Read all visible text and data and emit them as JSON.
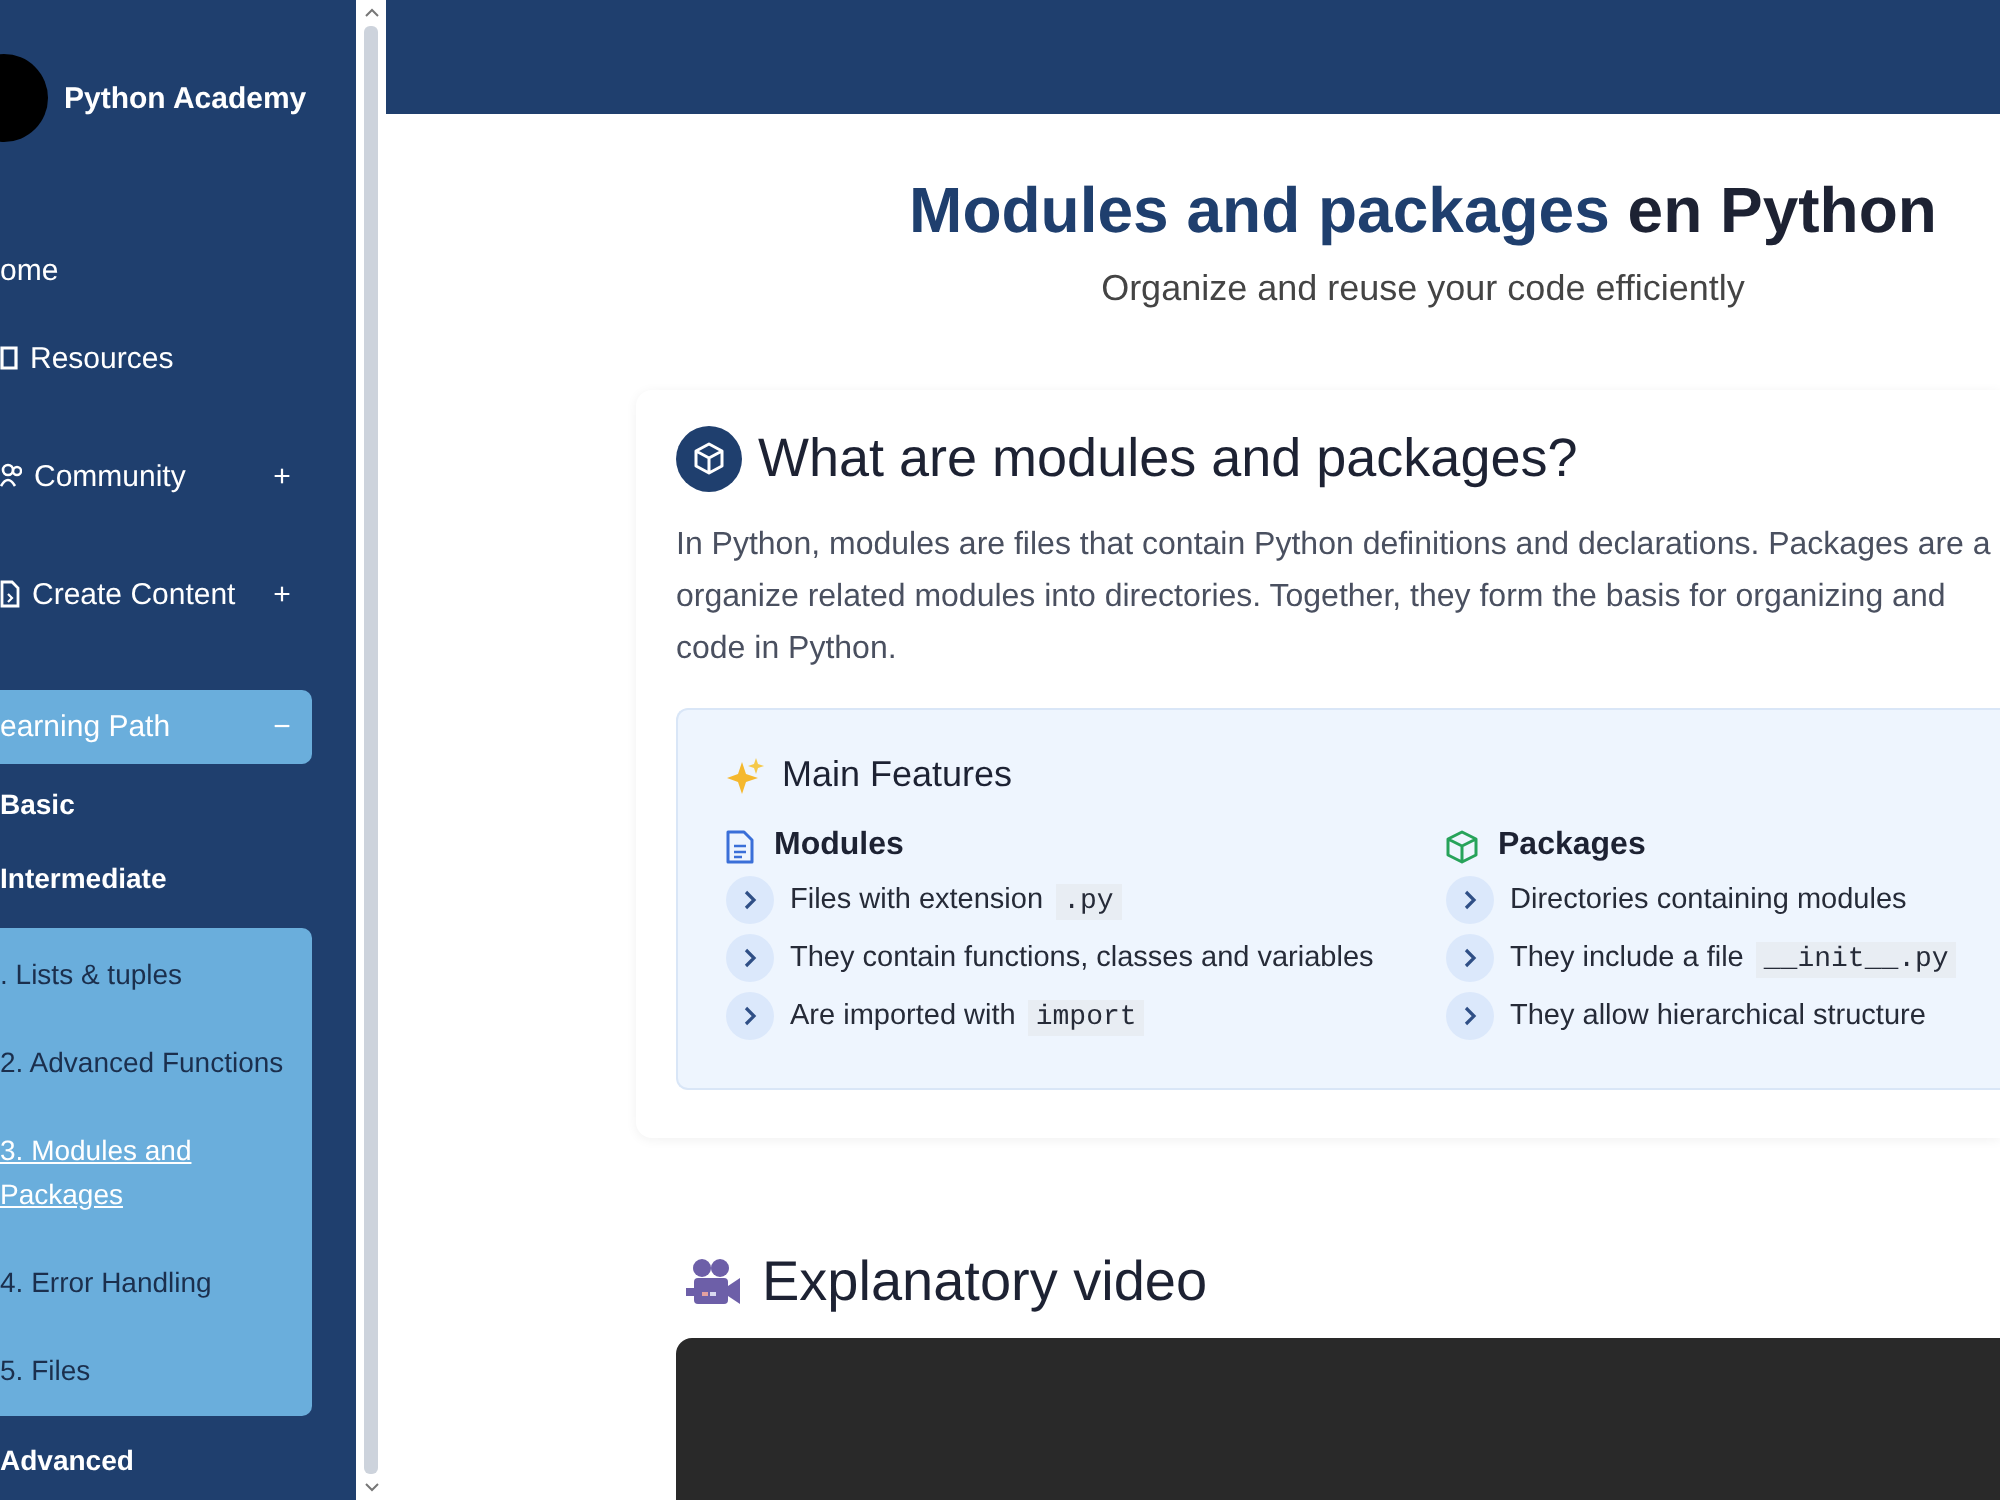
{
  "sidebar": {
    "brand": "Python Academy",
    "nav": [
      {
        "label": "ome",
        "kind": "link"
      },
      {
        "label": "Resources",
        "kind": "link"
      },
      {
        "label": "Community",
        "kind": "expandable",
        "toggle": "+",
        "expanded": false
      },
      {
        "label": "Create Content",
        "kind": "expandable",
        "toggle": "+",
        "expanded": false
      },
      {
        "label": "earning Path",
        "kind": "expandable",
        "toggle": "−",
        "expanded": true
      }
    ],
    "levels": [
      {
        "label": "Basic"
      },
      {
        "label": "Intermediate",
        "children": [
          {
            "label": ". Lists & tuples",
            "selected": false
          },
          {
            "label": "2. Advanced Functions",
            "selected": false
          },
          {
            "label": "3. Modules and Packages",
            "selected": true
          },
          {
            "label": "4. Error Handling",
            "selected": false
          },
          {
            "label": "5. Files",
            "selected": false
          }
        ]
      },
      {
        "label": "Advanced"
      }
    ]
  },
  "main": {
    "title": {
      "highlight": "Modules and packages",
      "rest": " en Python"
    },
    "subtitle": "Organize and reuse your code efficiently",
    "intro": {
      "heading": "What are modules and packages?",
      "text": "In Python, modules are files that contain Python definitions and declarations. Packages are a\norganize related modules into directories. Together, they form the basis for organizing and\ncode in Python."
    },
    "features": {
      "title": "Main Features",
      "columns": [
        {
          "title": "Modules",
          "items": [
            {
              "text": "Files with extension ",
              "code": ".py"
            },
            {
              "text": "They contain functions, classes and variables"
            },
            {
              "text": "Are imported with ",
              "code": "import"
            }
          ]
        },
        {
          "title": "Packages",
          "items": [
            {
              "text": "Directories containing modules"
            },
            {
              "text": "They include a file ",
              "code": "__init__.py"
            },
            {
              "text": "They allow hierarchical structure"
            }
          ]
        }
      ]
    },
    "video": {
      "heading": "Explanatory video"
    }
  }
}
